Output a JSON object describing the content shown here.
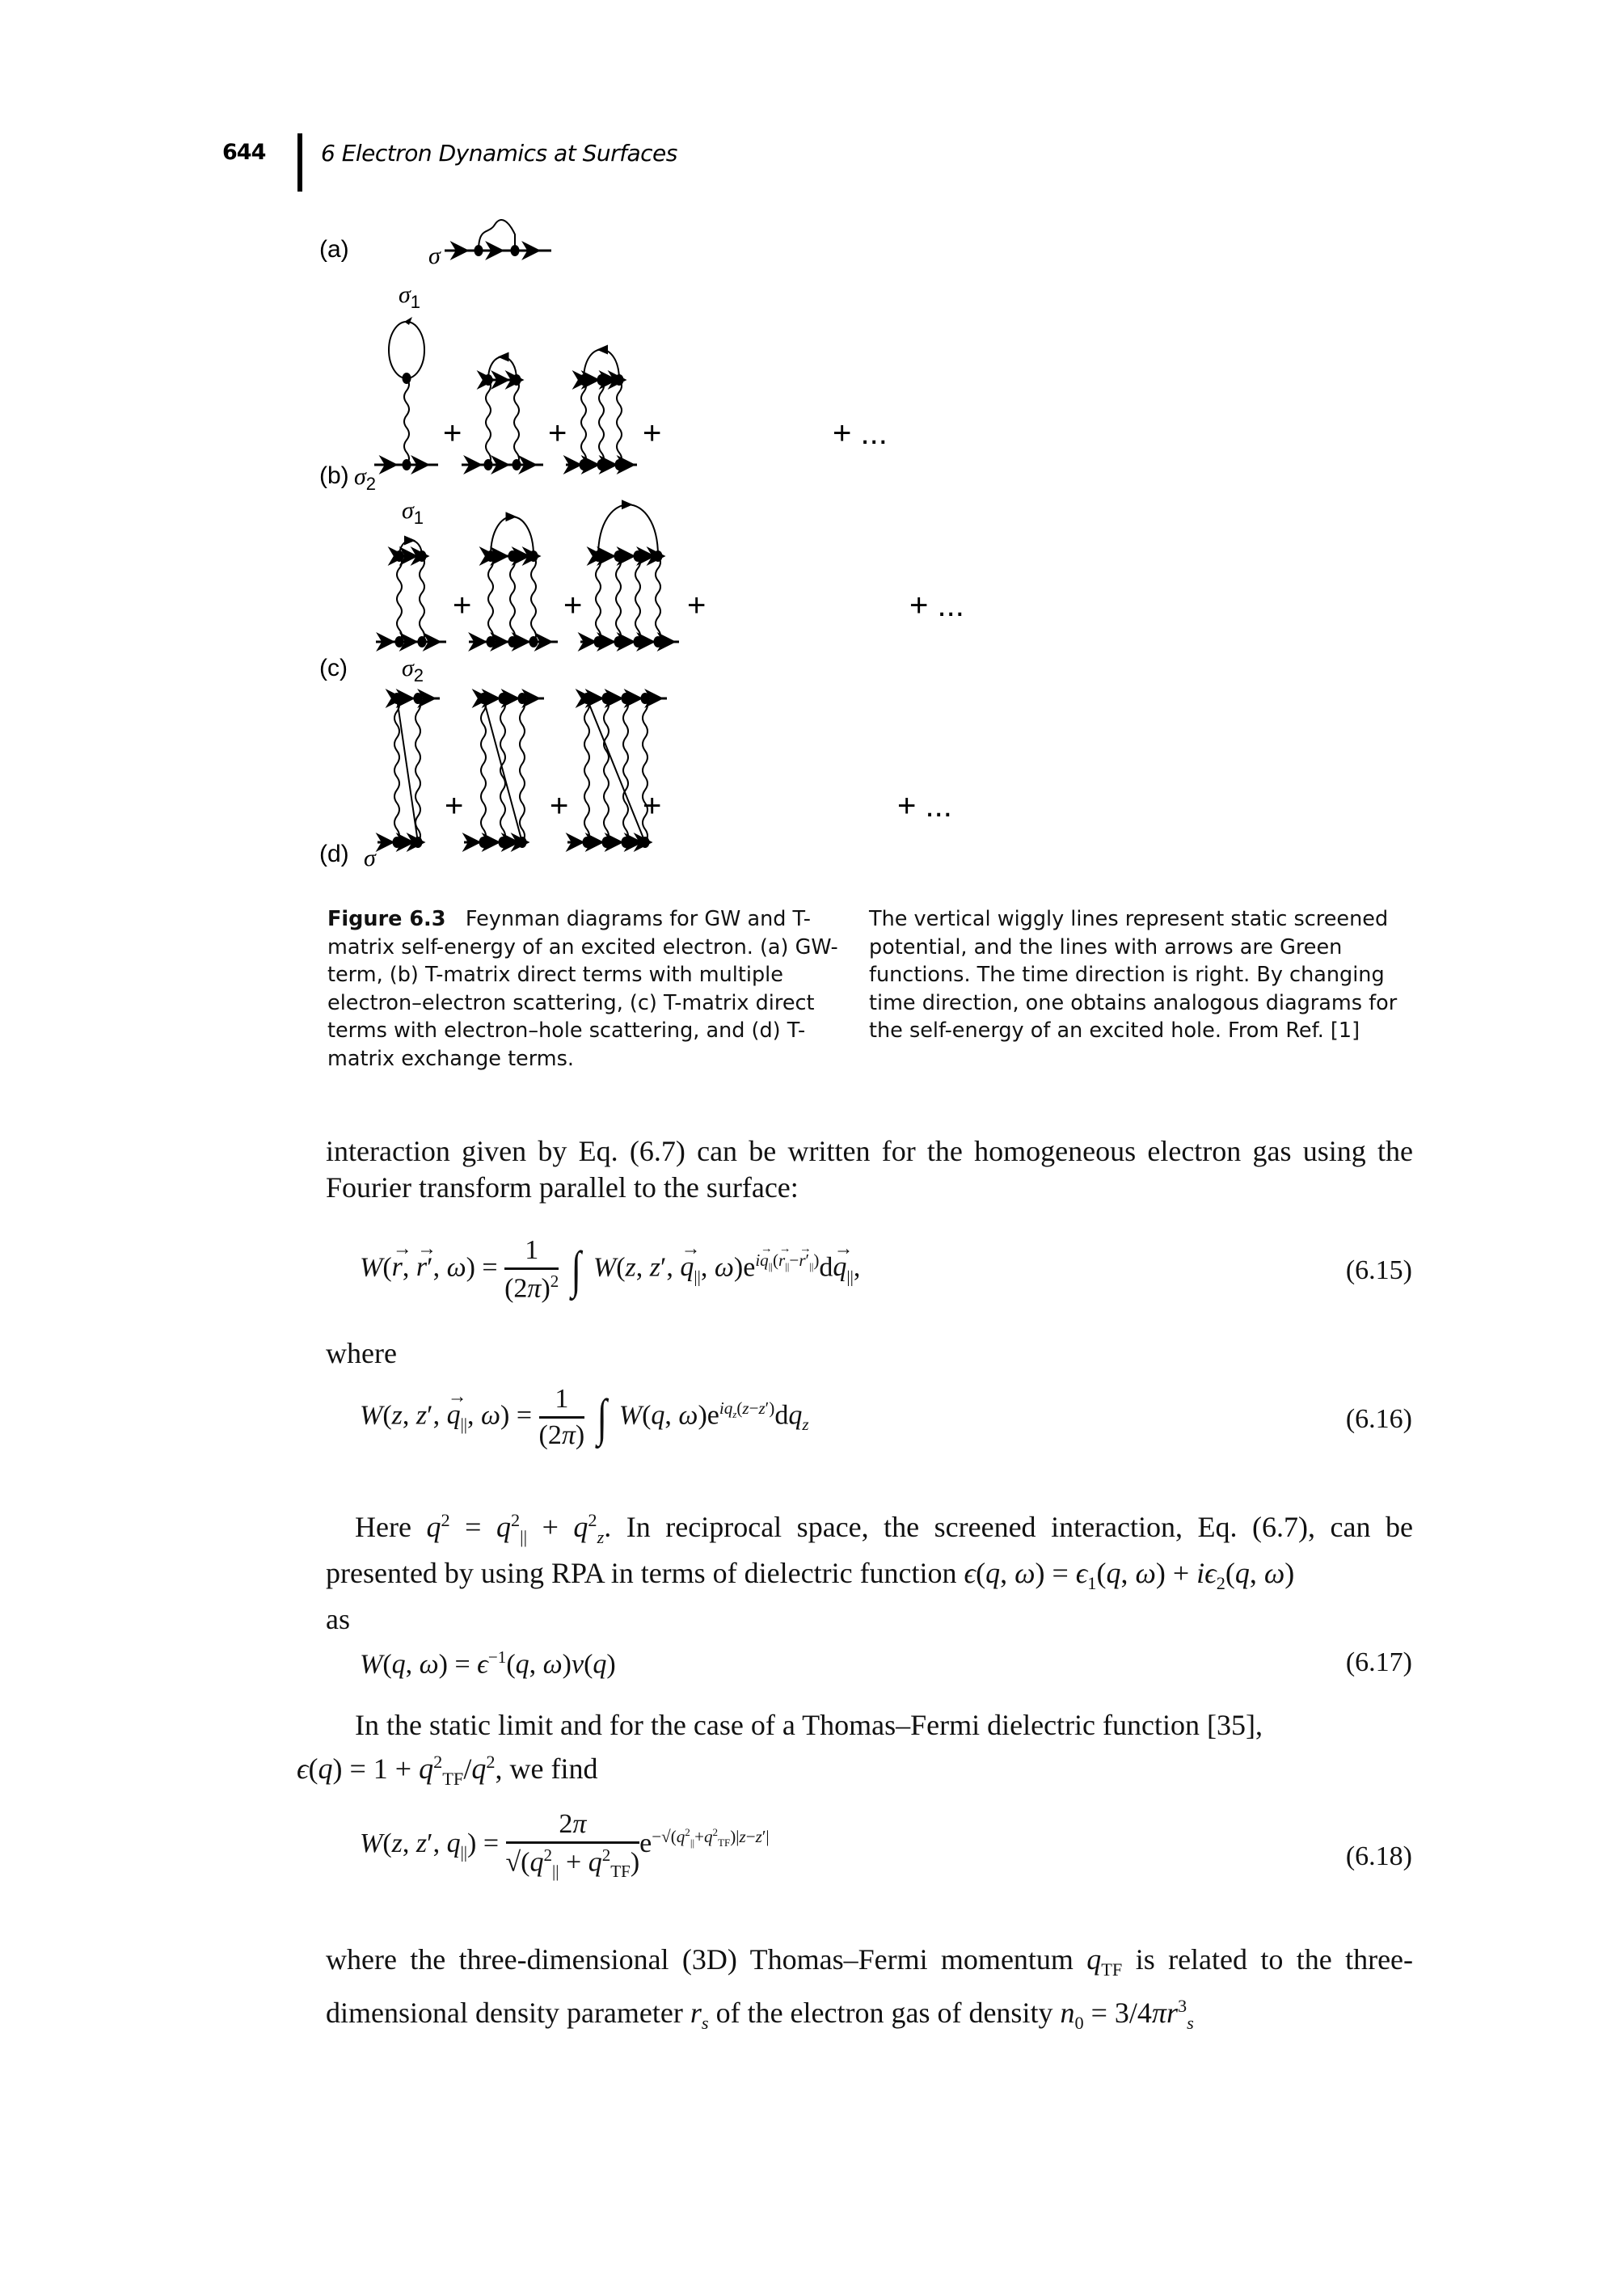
{
  "header": {
    "page_number": "644",
    "chapter_title": "6  Electron Dynamics at Surfaces"
  },
  "figure": {
    "panels": [
      {
        "label": "(a)",
        "sigma": "σ"
      },
      {
        "label": "(b)",
        "sigma": "σ",
        "sigma_sub": "2",
        "sigma_top": "σ",
        "sigma_top_sub": "1",
        "plus": "+",
        "ellipsis": "+ ..."
      },
      {
        "label": "(c)",
        "sigma": "σ",
        "sigma_sub": "2",
        "sigma_top": "σ",
        "sigma_top_sub": "1",
        "plus": "+",
        "ellipsis": "+ ..."
      },
      {
        "label": "(d)",
        "sigma": "σ",
        "plus": "+",
        "ellipsis": "+ ..."
      }
    ],
    "caption_label": "Figure 6.3",
    "caption_left": "Feynman diagrams for GW and T-matrix self-energy of an excited electron. (a) GW-term, (b) T-matrix direct terms with multiple electron–electron scattering, (c) T-matrix direct terms with electron–hole scattering, and (d) T-matrix exchange terms.",
    "caption_right": "The vertical wiggly lines represent static screened potential, and the lines with arrows are Green functions. The time direction is right. By changing time direction, one obtains analogous diagrams for the self-energy of an excited hole. From Ref. [1]"
  },
  "body": {
    "para1": "interaction given by Eq. (6.7) can be written for the homogeneous electron gas using the Fourier transform parallel to the surface:",
    "where": "where",
    "para2_a": "Here ",
    "para2_b": ". In reciprocal space, the screened interaction, Eq. (6.7), can be presented by using RPA in terms of dielectric function ",
    "para2_c": "as",
    "para3_a": "In the static limit and for the case of a Thomas–Fermi dielectric function [35],",
    "para3_b": ", we find",
    "para4": "where the three-dimensional (3D) Thomas–Fermi momentum",
    "para4_b": "is related to the three-dimensional density parameter",
    "para4_c": "of the electron gas of density"
  },
  "equations": [
    {
      "number": "(6.15)",
      "lhs": "W(r⃗, r⃗′, ω)",
      "latex": "W(\\vec r,\\vec r',\\omega)=\\frac{1}{(2\\pi)^2}\\int W(z,z',\\vec q_\\parallel,\\omega)e^{i\\vec q_\\parallel(\\vec r_\\parallel-\\vec r'_\\parallel)}d\\vec q_\\parallel,"
    },
    {
      "number": "(6.16)",
      "latex": "W(z,z',\\vec q_\\parallel,\\omega)=\\frac{1}{(2\\pi)}\\int W(q,\\omega)e^{iq_z(z-z')}dq_z"
    },
    {
      "number": "(6.17)",
      "latex": "W(q,\\omega)=\\epsilon^{-1}(q,\\omega)v(q)"
    },
    {
      "number": "(6.18)",
      "latex": "W(z,z',q_\\parallel)=\\frac{2\\pi}{\\sqrt{q_\\parallel^2+q_{TF}^2}}e^{-\\sqrt{q_\\parallel^2+q_{TF}^2}|z-z'|}"
    }
  ]
}
